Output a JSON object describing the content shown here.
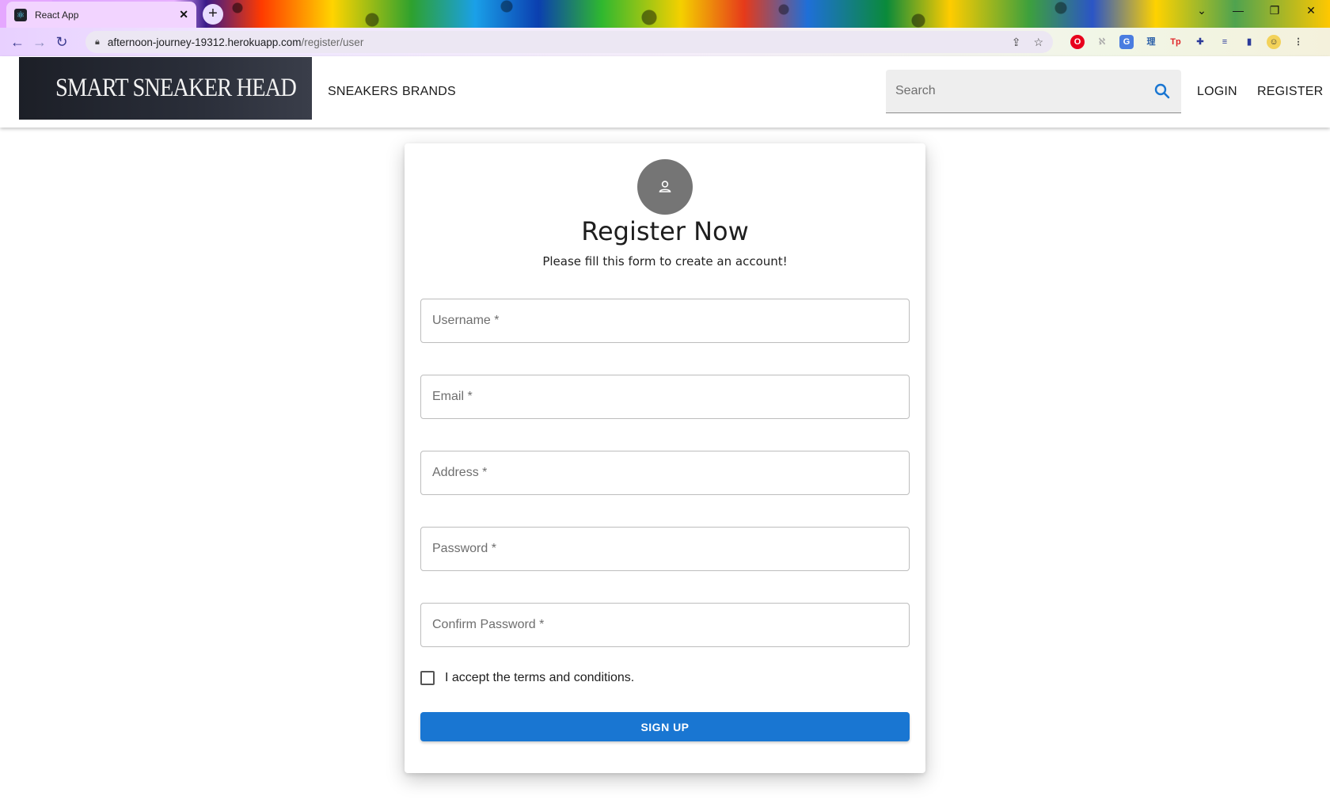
{
  "browser": {
    "tab_title": "React App",
    "tab_favicon": "react-icon",
    "url_host": "afternoon-journey-19312.herokuapp.com",
    "url_path": "/register/user",
    "window_controls": [
      "minimize",
      "restore",
      "close"
    ],
    "extensions": [
      "opera-ext",
      "ext-grey",
      "translate-ext",
      "dictionary-ext",
      "tp-ext",
      "puzzle-ext",
      "media-ext",
      "sidepanel-ext",
      "profile-avatar",
      "menu-dots"
    ]
  },
  "header": {
    "logo_text": "SMART SNEAKER HEAD",
    "nav": {
      "sneakers": "SNEAKERS",
      "brands": "BRANDS",
      "login": "LOGIN",
      "register": "REGISTER"
    },
    "search": {
      "placeholder": "Search",
      "icon": "search-icon"
    }
  },
  "form": {
    "title": "Register Now",
    "subtitle": "Please fill this form to create an account!",
    "avatar_icon": "person-icon",
    "fields": {
      "username": "Username *",
      "email": "Email *",
      "address": "Address *",
      "password": "Password *",
      "confirm_password": "Confirm Password *"
    },
    "terms_label": "I accept the terms and conditions.",
    "terms_checked": false,
    "submit_label": "SIGN UP"
  },
  "colors": {
    "primary": "#1976d2",
    "avatar_bg": "#757575",
    "logo_bg": "#1c1f27"
  }
}
